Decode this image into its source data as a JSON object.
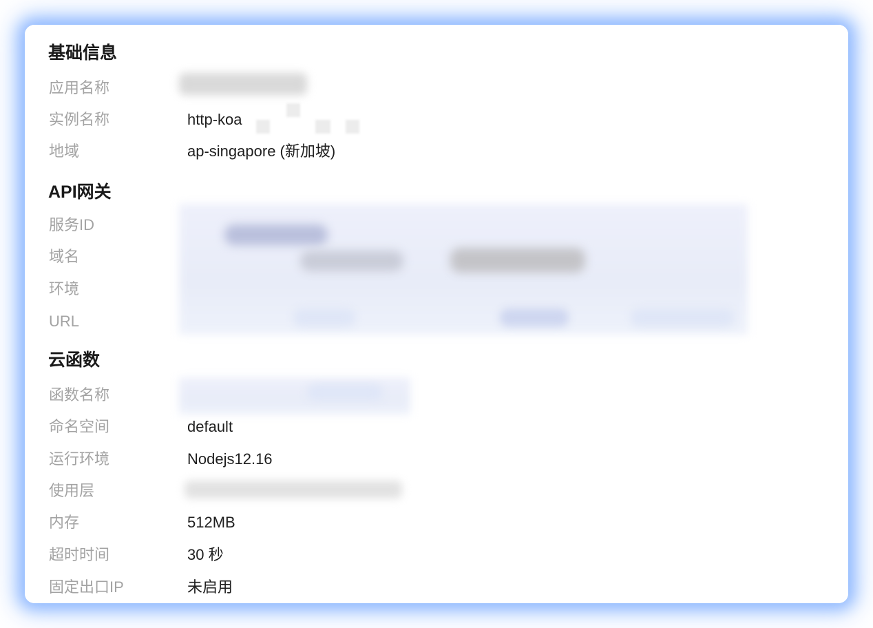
{
  "sections": {
    "basic": {
      "title": "基础信息",
      "app_name_label": "应用名称",
      "instance_name_label": "实例名称",
      "instance_name_value": "http-koa",
      "region_label": "地域",
      "region_value": "ap-singapore (新加坡)"
    },
    "api_gateway": {
      "title": "API网关",
      "service_id_label": "服务ID",
      "domain_label": "域名",
      "environment_label": "环境",
      "url_label": "URL"
    },
    "cloud_function": {
      "title": "云函数",
      "function_name_label": "函数名称",
      "namespace_label": "命名空间",
      "namespace_value": "default",
      "runtime_label": "运行环境",
      "runtime_value": "Nodejs12.16",
      "layers_label": "使用层",
      "memory_label": "内存",
      "memory_value": "512MB",
      "timeout_label": "超时时间",
      "timeout_value": "30 秒",
      "fixed_egress_ip_label": "固定出口IP",
      "fixed_egress_ip_value": "未启用"
    }
  },
  "colors": {
    "glow": "#7aaaff",
    "title": "#1a1a1a",
    "label": "#a3a3a3",
    "value": "#1e1e1e"
  }
}
